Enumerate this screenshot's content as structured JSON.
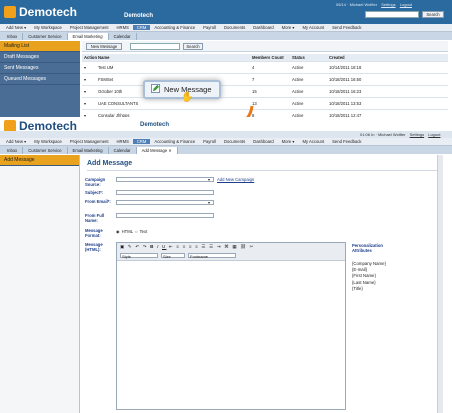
{
  "top": {
    "logo": "Demotech",
    "app_title": "Demotech",
    "user_text": "05/14 · Michael Wolfter",
    "settings": "Settings",
    "logout": "Logout",
    "search_btn": "Search",
    "nav": [
      "Add New ▾",
      "My Workspace",
      "Project Management",
      "HRMS",
      "CRM",
      "Accounting & Finance",
      "Payroll",
      "Documents",
      "Dashboard",
      "More ▾",
      "My Account",
      "Send Feedback"
    ],
    "nav_active": 4,
    "subnav": [
      "Inbox",
      "Customer Service",
      "Email Marketing",
      "Calendar"
    ],
    "subnav_active": 2,
    "sidebar": [
      "Mailing List",
      "Draft Messages",
      "Sent Messages",
      "Queued Messages"
    ],
    "new_message_btn": "New Message",
    "search_button": "Search",
    "table_headers": [
      "Action",
      "Name",
      "Members Count",
      "Status",
      "Created"
    ],
    "rows": [
      [
        "▾",
        "Test UM",
        "4",
        "Active",
        "10/14/2011 18:18"
      ],
      [
        "▾",
        "FSMSet",
        "7",
        "Active",
        "10/18/2011 16:50"
      ],
      [
        "▾",
        "October 10th",
        "15",
        "Active",
        "10/18/2011 16:23"
      ],
      [
        "▾",
        "UAE CONSULTANTS",
        "13",
        "Active",
        "10/18/2011 13:53"
      ],
      [
        "▾",
        "Consular Jhhpps",
        "8",
        "Active",
        "10/18/2011 12:47"
      ]
    ]
  },
  "callout": {
    "label": "New Message"
  },
  "bottom": {
    "logo": "Demotech",
    "app_title": "Demotech",
    "user_text": "01:06 In · Michael Wolfter",
    "settings": "Settings",
    "logout": "Logout",
    "nav": [
      "Add New ▾",
      "My Workspace",
      "Project Management",
      "HRMS",
      "CRM",
      "Accounting & Finance",
      "Payroll",
      "Documents",
      "Dashboard",
      "More ▾",
      "My Account",
      "Send Feedback"
    ],
    "nav_active": 4,
    "subnav": [
      "Inbox",
      "Customer Service",
      "Email Marketing",
      "Calendar",
      "Add Message ✕"
    ],
    "subnav_active": 4,
    "sidebar": [
      "Add Message"
    ],
    "page_title": "Add Message",
    "labels": {
      "campaign": "Campaign Source:",
      "subject": "Subject*:",
      "from_email": "From Email*:",
      "from_name": "From Full Name:",
      "format": "Message Format:",
      "message": "Message (HTML):"
    },
    "add_campaign_link": "Add New Campaign",
    "radio_html": "HTML",
    "radio_text": "Text",
    "style_select": "Style",
    "size_select": "Size",
    "font_select": "Fontname",
    "personalization_title": "Personalization Attributes",
    "attributes": [
      "{Company Name}",
      "{E-mail}",
      "{First Name}",
      "{Last Name}",
      "{Title}"
    ]
  },
  "colors": {
    "header": "#2b6a9e",
    "accent": "#e9a21d",
    "arrow": "#e87a1b"
  }
}
